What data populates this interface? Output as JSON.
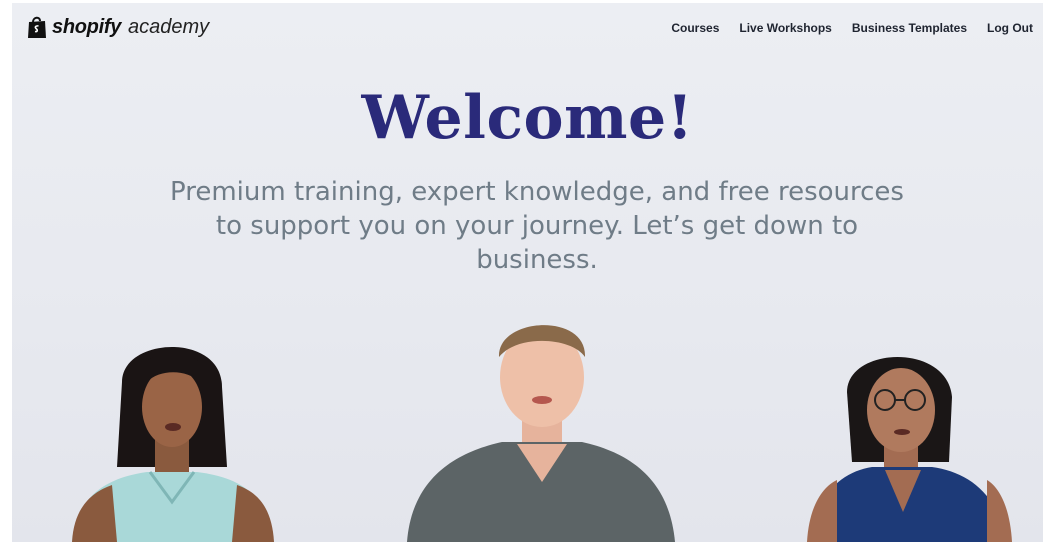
{
  "header": {
    "logo": {
      "brand": "shopify",
      "product": "academy",
      "icon": "shopping-bag-icon"
    },
    "nav": [
      {
        "label": "Courses"
      },
      {
        "label": "Live Workshops"
      },
      {
        "label": "Business Templates"
      },
      {
        "label": "Log Out"
      }
    ]
  },
  "hero": {
    "title": "Welcome!",
    "subtitle": "Premium training, expert knowledge, and free resources to support you on your journey. Let’s get down to business."
  },
  "colors": {
    "title": "#2a2a7a",
    "subtitle": "#6f7c87",
    "background": "#e9ebf0"
  }
}
